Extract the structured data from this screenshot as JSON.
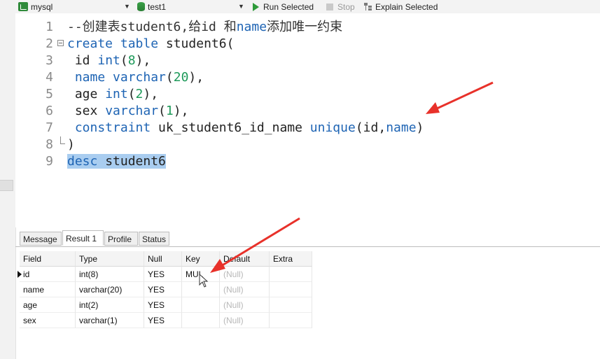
{
  "toolbar": {
    "connection": "mysql",
    "database": "test1",
    "run_selected": "Run Selected",
    "stop": "Stop",
    "explain_selected": "Explain Selected"
  },
  "editor": {
    "lines": [
      {
        "num": "1",
        "parts": [
          {
            "t": "--创建表student6,给id 和",
            "c": "cm"
          },
          {
            "t": "name",
            "c": "kw"
          },
          {
            "t": "添加唯一约束",
            "c": "cm"
          }
        ]
      },
      {
        "num": "2",
        "parts": [
          {
            "t": "create table",
            "c": "kw"
          },
          {
            "t": " student6(",
            "c": ""
          }
        ]
      },
      {
        "num": "3",
        "parts": [
          {
            "t": " id ",
            "c": ""
          },
          {
            "t": "int",
            "c": "kw"
          },
          {
            "t": "(",
            "c": ""
          },
          {
            "t": "8",
            "c": "num"
          },
          {
            "t": "),",
            "c": ""
          }
        ]
      },
      {
        "num": "4",
        "parts": [
          {
            "t": " name varchar",
            "c": "kw"
          },
          {
            "t": "(",
            "c": ""
          },
          {
            "t": "20",
            "c": "num"
          },
          {
            "t": "),",
            "c": ""
          }
        ]
      },
      {
        "num": "5",
        "parts": [
          {
            "t": " age ",
            "c": ""
          },
          {
            "t": "int",
            "c": "kw"
          },
          {
            "t": "(",
            "c": ""
          },
          {
            "t": "2",
            "c": "num"
          },
          {
            "t": "),",
            "c": ""
          }
        ]
      },
      {
        "num": "6",
        "parts": [
          {
            "t": " sex ",
            "c": ""
          },
          {
            "t": "varchar",
            "c": "kw"
          },
          {
            "t": "(",
            "c": ""
          },
          {
            "t": "1",
            "c": "num"
          },
          {
            "t": "),",
            "c": ""
          }
        ]
      },
      {
        "num": "7",
        "parts": [
          {
            "t": " constraint",
            "c": "kw"
          },
          {
            "t": " uk_student6_id_name ",
            "c": ""
          },
          {
            "t": "unique",
            "c": "kw"
          },
          {
            "t": "(id,",
            "c": ""
          },
          {
            "t": "name",
            "c": "kw"
          },
          {
            "t": ")",
            "c": ""
          }
        ]
      },
      {
        "num": "8",
        "parts": [
          {
            "t": ")",
            "c": ""
          }
        ]
      },
      {
        "num": "9",
        "parts": [
          {
            "t": "desc",
            "c": "kw sel"
          },
          {
            "t": " student6",
            "c": "sel"
          }
        ]
      }
    ]
  },
  "result_tabs": [
    "Message",
    "Result 1",
    "Profile",
    "Status"
  ],
  "result_grid": {
    "columns": [
      "Field",
      "Type",
      "Null",
      "Key",
      "Default",
      "Extra"
    ],
    "rows": [
      [
        "id",
        "int(8)",
        "YES",
        "MUL",
        "(Null)",
        ""
      ],
      [
        "name",
        "varchar(20)",
        "YES",
        "",
        "(Null)",
        ""
      ],
      [
        "age",
        "int(2)",
        "YES",
        "",
        "(Null)",
        ""
      ],
      [
        "sex",
        "varchar(1)",
        "YES",
        "",
        "(Null)",
        ""
      ]
    ]
  },
  "colors": {
    "keyword": "#1e64b4",
    "number": "#1e9a5a",
    "annotation_arrow": "#e8312a",
    "selection": "#a9cdf0"
  }
}
